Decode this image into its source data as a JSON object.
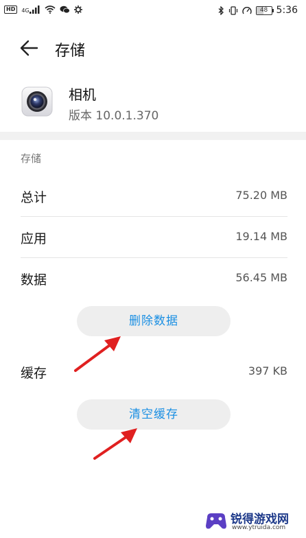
{
  "status_bar": {
    "hd_label": "HD",
    "signal_label": "4G",
    "battery_level": "48",
    "time": "5:36"
  },
  "app_bar": {
    "title": "存储"
  },
  "app_info": {
    "name": "相机",
    "version": "版本 10.0.1.370"
  },
  "storage": {
    "section_label": "存储",
    "rows": [
      {
        "label": "总计",
        "value": "75.20 MB"
      },
      {
        "label": "应用",
        "value": "19.14 MB"
      },
      {
        "label": "数据",
        "value": "56.45 MB"
      }
    ],
    "delete_data_label": "删除数据",
    "cache": {
      "label": "缓存",
      "value": "397 KB"
    },
    "clear_cache_label": "清空缓存"
  },
  "icons": {
    "back": "arrow-left-icon",
    "camera": "camera-app-icon",
    "annotation": "red-arrow-icon"
  },
  "colors": {
    "accent": "#1a8fe3",
    "annotation": "#e02020",
    "button_bg": "#eeeeee",
    "divider": "#f1f1f1"
  },
  "watermark": {
    "title": "锐得游戏网",
    "url": "www.ytruida.com"
  }
}
